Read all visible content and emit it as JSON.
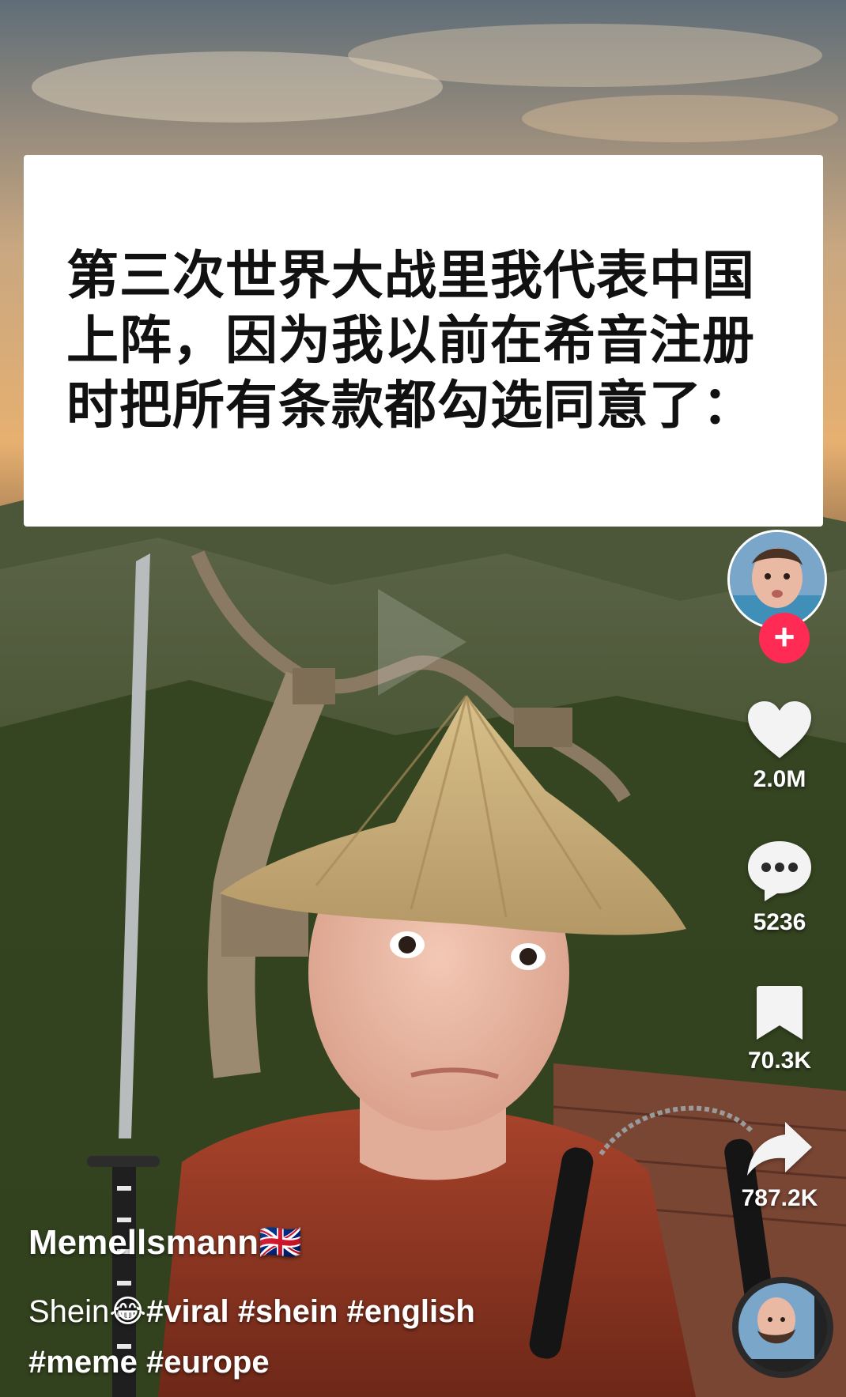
{
  "caption": {
    "text": "第三次世界大战里我代表中国\n上阵，因为我以前在希音注册\n时把所有条款都勾选同意了："
  },
  "actions": {
    "like_count": "2.0M",
    "comment_count": "5236",
    "bookmark_count": "70.3K",
    "share_count": "787.2K"
  },
  "author": {
    "username": "Memellsmann🇬🇧"
  },
  "description": {
    "text_prefix": "Shein😂",
    "hashtags": [
      "#viral",
      "#shein",
      "#english",
      "#meme",
      "#europe"
    ]
  },
  "icons": {
    "like": "heart-icon",
    "comment": "comment-bubble-icon",
    "bookmark": "bookmark-icon",
    "share": "share-arrow-icon",
    "follow": "plus-icon"
  },
  "colors": {
    "follow_button": "#ff2b54",
    "caption_card": "#ffffff",
    "caption_text": "#111111",
    "overlay_text": "#ffffff"
  }
}
